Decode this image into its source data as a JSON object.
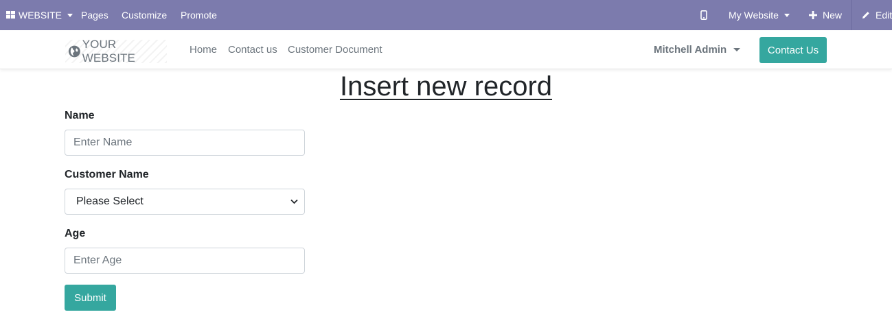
{
  "admin_bar": {
    "website_menu": "WEBSITE",
    "items": [
      "Pages",
      "Customize",
      "Promote"
    ],
    "website_selector": "My Website",
    "new_label": "New",
    "edit_label": "Edit",
    "background": "#7c7bad"
  },
  "navbar": {
    "logo_text": "YOUR WEBSITE",
    "links": [
      "Home",
      "Contact us",
      "Customer Document"
    ],
    "user_name": "Mitchell Admin",
    "contact_button": "Contact Us"
  },
  "form": {
    "title": "Insert new record",
    "name_label": "Name",
    "name_placeholder": "Enter Name",
    "customer_label": "Customer Name",
    "customer_selected": "Please Select",
    "age_label": "Age",
    "age_placeholder": "Enter Age",
    "submit_label": "Submit"
  },
  "colors": {
    "accent": "#35a79f",
    "admin_bar": "#7c7bad"
  }
}
